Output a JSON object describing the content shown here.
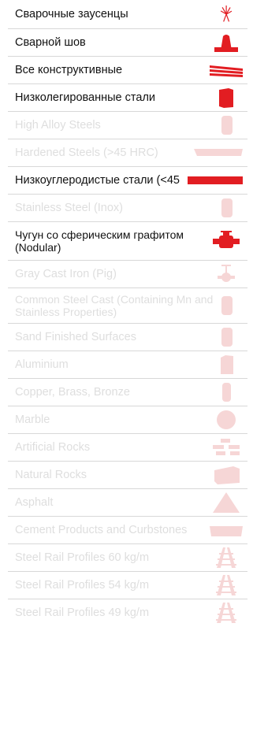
{
  "colors": {
    "accent": "#e21d22",
    "accent_faded": "#f6d6d6",
    "text_active": "#111111",
    "text_inactive": "#dedede"
  },
  "items": [
    {
      "label": "Сварочные заусенцы",
      "icon": "weld-burr-sparks-icon",
      "active": true
    },
    {
      "label": "Сварной шов",
      "icon": "weld-seam-icon",
      "active": true
    },
    {
      "label": "Все конструктивные",
      "icon": "steel-beams-icon",
      "active": true
    },
    {
      "label": "Низколегированные стали",
      "icon": "steel-plate-icon",
      "active": true
    },
    {
      "label": "High Alloy Steels",
      "icon": "cylinder-icon",
      "active": false
    },
    {
      "label": "Hardened Steels (>45 HRC)",
      "icon": "flat-plate-icon",
      "active": false
    },
    {
      "label": "Низкоуглеродистые стали (<45",
      "icon": "flat-bar-icon",
      "active": true
    },
    {
      "label": "Stainless Steel (Inox)",
      "icon": "cylinder-icon",
      "active": false
    },
    {
      "label": "Чугун со сферическим графитом (Nodular)",
      "icon": "pump-valve-icon",
      "active": true
    },
    {
      "label": "Gray Cast Iron (Pig)",
      "icon": "valve-icon",
      "active": false
    },
    {
      "label": "Common Steel Cast (Containing Mn and Stainless Properties)",
      "icon": "cylinder-icon",
      "active": false
    },
    {
      "label": "Sand Finished Surfaces",
      "icon": "cylinder-icon",
      "active": false
    },
    {
      "label": "Aluminium",
      "icon": "profile-block-icon",
      "active": false
    },
    {
      "label": "Copper, Brass, Bronze",
      "icon": "cylinder-icon",
      "active": false
    },
    {
      "label": "Marble",
      "icon": "marble-block-icon",
      "active": false
    },
    {
      "label": "Artificial Rocks",
      "icon": "bricks-icon",
      "active": false
    },
    {
      "label": "Natural Rocks",
      "icon": "stone-block-icon",
      "active": false
    },
    {
      "label": "Asphalt",
      "icon": "asphalt-pile-icon",
      "active": false
    },
    {
      "label": "Cement Products and Curbstones",
      "icon": "curbstone-icon",
      "active": false
    },
    {
      "label": "Steel Rail Profiles 60 kg/m",
      "icon": "rail-track-icon",
      "active": false
    },
    {
      "label": "Steel Rail Profiles 54 kg/m",
      "icon": "rail-track-icon",
      "active": false
    },
    {
      "label": "Steel Rail Profiles 49 kg/m",
      "icon": "rail-track-icon",
      "active": false
    }
  ]
}
